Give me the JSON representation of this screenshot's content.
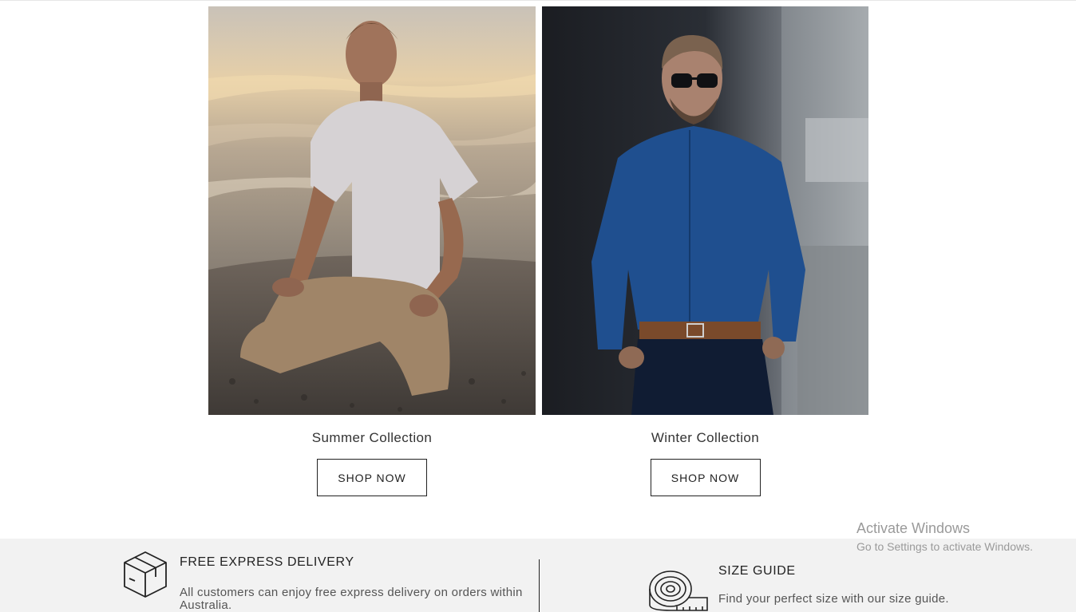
{
  "collections": [
    {
      "title": "Summer Collection",
      "button": "SHOP NOW"
    },
    {
      "title": "Winter Collection",
      "button": "SHOP NOW"
    }
  ],
  "features": {
    "delivery": {
      "icon": "package-box-icon",
      "title": "FREE EXPRESS DELIVERY",
      "text": "All customers can enjoy free express delivery on orders within Australia."
    },
    "size_guide": {
      "icon": "tape-measure-icon",
      "title": "SIZE GUIDE",
      "text": "Find your perfect size with our size guide."
    }
  },
  "watermark": {
    "title": "Activate Windows",
    "subtitle": "Go to Settings to activate Windows."
  }
}
